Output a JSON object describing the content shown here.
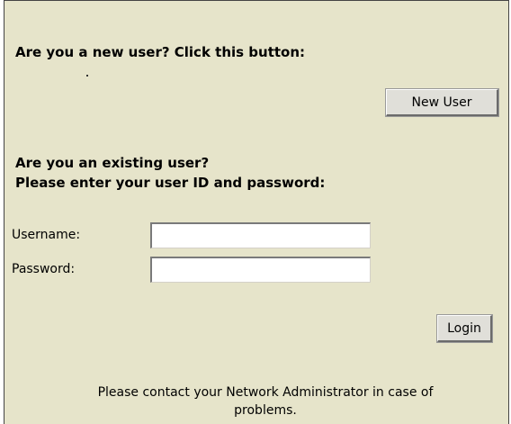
{
  "new_user_section": {
    "heading": "Are you a new user? Click this button:",
    "button_label": "New User"
  },
  "existing_user_section": {
    "heading_line1": "Are you an existing user?",
    "heading_line2": "Please enter your user ID and password:"
  },
  "form": {
    "username_label": "Username:",
    "username_value": "",
    "password_label": "Password:",
    "password_value": "",
    "login_label": "Login"
  },
  "footer": {
    "line1": "Please contact your Network Administrator in case of",
    "line2": "problems."
  },
  "colors": {
    "panel_background": "#e6e4ca",
    "button_face": "#e0dfd9"
  }
}
